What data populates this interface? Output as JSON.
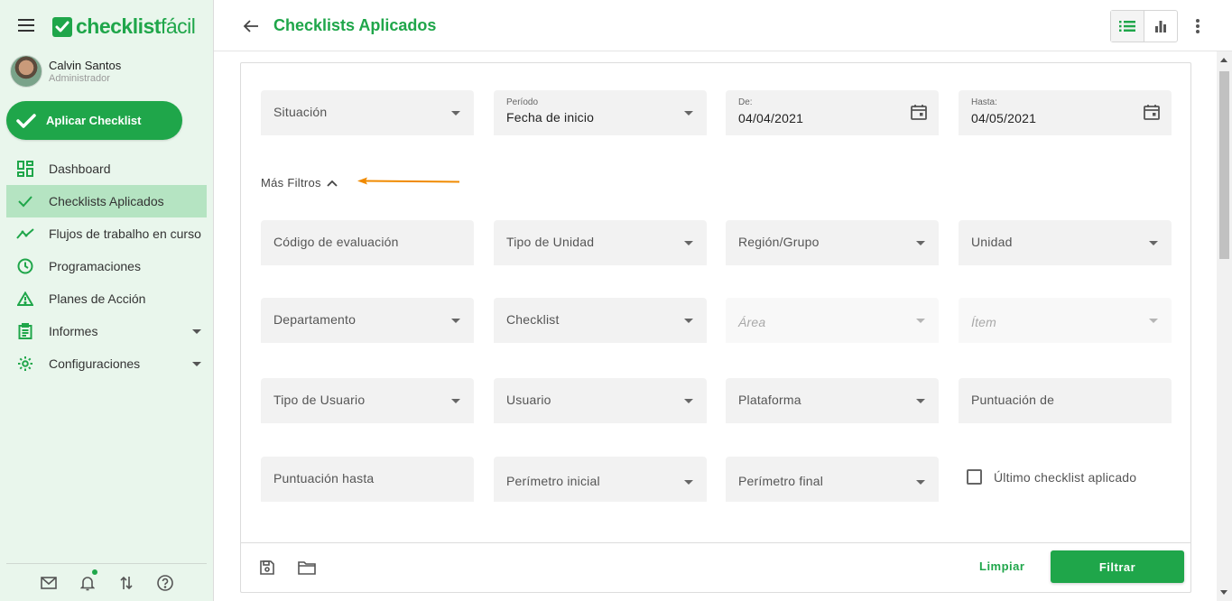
{
  "app": {
    "logo_main": "checklist",
    "logo_light": "fácil"
  },
  "user": {
    "name": "Calvin Santos",
    "role": "Administrador"
  },
  "apply_button": "Aplicar Checklist",
  "nav": [
    {
      "label": "Dashboard",
      "icon": "dashboard-icon"
    },
    {
      "label": "Checklists Aplicados",
      "icon": "check-icon",
      "active": true
    },
    {
      "label": "Flujos de trabalho en curso",
      "icon": "trending-icon"
    },
    {
      "label": "Programaciones",
      "icon": "clock-icon"
    },
    {
      "label": "Planes de Acción",
      "icon": "warning-icon"
    },
    {
      "label": "Informes",
      "icon": "clipboard-icon",
      "expandable": true
    },
    {
      "label": "Configuraciones",
      "icon": "gear-icon",
      "expandable": true
    }
  ],
  "header": {
    "title": "Checklists Aplicados"
  },
  "filters": {
    "situacion": "Situación",
    "periodo_label": "Período",
    "periodo_value": "Fecha de inicio",
    "de_label": "De:",
    "de_value": "04/04/2021",
    "hasta_label": "Hasta:",
    "hasta_value": "04/05/2021",
    "mas_filtros": "Más Filtros",
    "codigo": "Código de evaluación",
    "tipo_unidad": "Tipo de Unidad",
    "region": "Región/Grupo",
    "unidad": "Unidad",
    "departamento": "Departamento",
    "checklist": "Checklist",
    "area": "Área",
    "item": "Ítem",
    "tipo_usuario": "Tipo de Usuario",
    "usuario": "Usuario",
    "plataforma": "Plataforma",
    "puntuacion_de": "Puntuación de",
    "puntuacion_hasta": "Puntuación hasta",
    "perimetro_inicial": "Perímetro inicial",
    "perimetro_final": "Perímetro final",
    "ultimo_checklist": "Último checklist aplicado"
  },
  "footer": {
    "clear": "Limpiar",
    "filter": "Filtrar"
  },
  "colors": {
    "brand": "#1fa64a",
    "sidebar_bg": "#e9f6ec",
    "active_nav": "#b5e4c2",
    "annotation_arrow": "#f08a00"
  }
}
